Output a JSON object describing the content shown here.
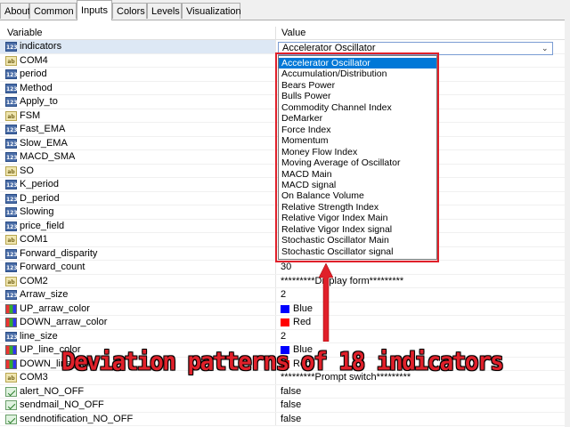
{
  "tabs": [
    "About",
    "Common",
    "Inputs",
    "Colors",
    "Levels",
    "Visualization"
  ],
  "active_tab": "Inputs",
  "columns": {
    "variable": "Variable",
    "value": "Value"
  },
  "rows": [
    {
      "icon": "num",
      "name": "indicators",
      "value": "Accelerator Oscillator"
    },
    {
      "icon": "txt",
      "name": "COM4",
      "value": ""
    },
    {
      "icon": "num",
      "name": "period",
      "value": ""
    },
    {
      "icon": "num",
      "name": "Method",
      "value": ""
    },
    {
      "icon": "num",
      "name": "Apply_to",
      "value": ""
    },
    {
      "icon": "txt",
      "name": "FSM",
      "value": ""
    },
    {
      "icon": "num",
      "name": "Fast_EMA",
      "value": ""
    },
    {
      "icon": "num",
      "name": "Slow_EMA",
      "value": ""
    },
    {
      "icon": "num",
      "name": "MACD_SMA",
      "value": ""
    },
    {
      "icon": "txt",
      "name": "SO",
      "value": ""
    },
    {
      "icon": "num",
      "name": "K_period",
      "value": ""
    },
    {
      "icon": "num",
      "name": "D_period",
      "value": ""
    },
    {
      "icon": "num",
      "name": "Slowing",
      "value": ""
    },
    {
      "icon": "num",
      "name": "price_field",
      "value": ""
    },
    {
      "icon": "txt",
      "name": "COM1",
      "value": ""
    },
    {
      "icon": "num",
      "name": "Forward_disparity",
      "value": ""
    },
    {
      "icon": "num",
      "name": "Forward_count",
      "value": "30"
    },
    {
      "icon": "txt",
      "name": "COM2",
      "value": "*********Display form*********"
    },
    {
      "icon": "num",
      "name": "Arraw_size",
      "value": "2"
    },
    {
      "icon": "clr",
      "name": "UP_arraw_color",
      "value": "Blue",
      "swatch": "#0000ff"
    },
    {
      "icon": "clr",
      "name": "DOWN_arraw_color",
      "value": "Red",
      "swatch": "#ff0000"
    },
    {
      "icon": "num",
      "name": "line_size",
      "value": "2"
    },
    {
      "icon": "clr",
      "name": "UP_line_color",
      "value": "Blue",
      "swatch": "#0000ff"
    },
    {
      "icon": "clr",
      "name": "DOWN_line_color",
      "value": "Red",
      "swatch": "#ff0000"
    },
    {
      "icon": "txt",
      "name": "COM3",
      "value": "*********Prompt switch*********"
    },
    {
      "icon": "bool",
      "name": "alert_NO_OFF",
      "value": "false"
    },
    {
      "icon": "bool",
      "name": "sendmail_NO_OFF",
      "value": "false"
    },
    {
      "icon": "bool",
      "name": "sendnotification_NO_OFF",
      "value": "false"
    }
  ],
  "combo": {
    "value": "Accelerator Oscillator"
  },
  "dropdown_options": [
    "Accelerator Oscillator",
    "Accumulation/Distribution",
    "Bears Power",
    "Bulls Power",
    "Commodity Channel Index",
    "DeMarker",
    "Force Index",
    "Momentum",
    "Money Flow Index",
    "Moving Average of Oscillator",
    "MACD Main",
    "MACD signal",
    "On Balance Volume",
    "Relative Strength Index",
    "Relative Vigor Index Main",
    "Relative Vigor Index signal",
    "Stochastic Oscillator Main",
    "Stochastic Oscillator signal"
  ],
  "selected_option": "Accelerator Oscillator",
  "annotation": {
    "caption": "Deviation patterns of 18 indicators",
    "color": "#e0202a"
  },
  "colors": {
    "selection": "#0078d7",
    "highlight_box": "#e0202a"
  }
}
